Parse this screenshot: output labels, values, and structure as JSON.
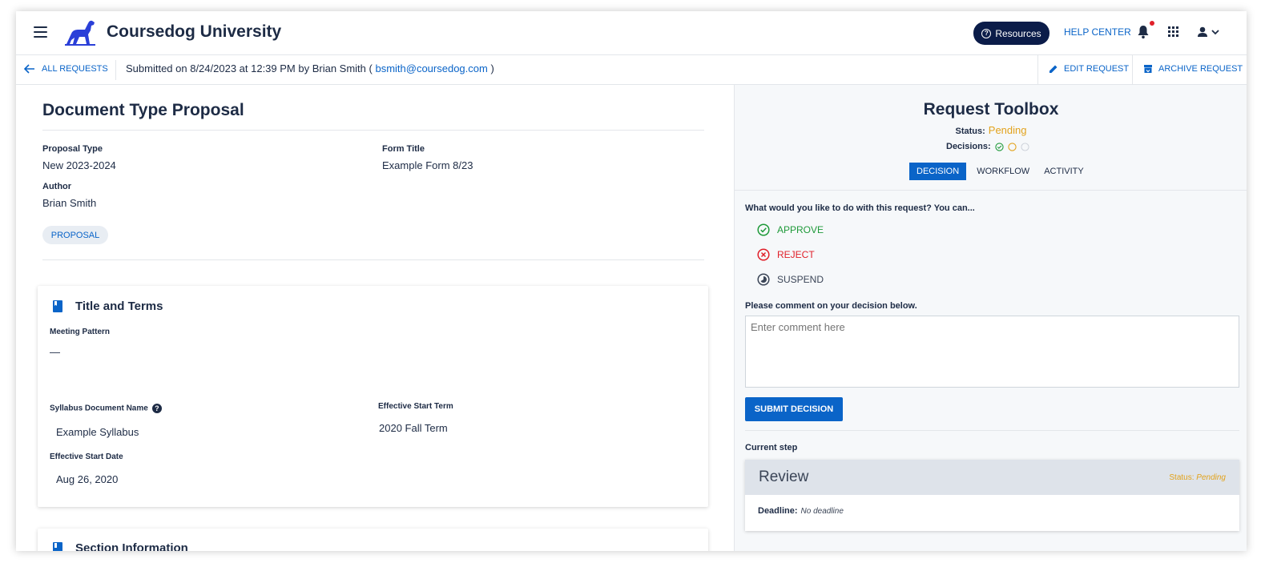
{
  "app": {
    "brand": "Coursedog University",
    "resources_label": "Resources",
    "help_center_label": "HELP CENTER",
    "icons": [
      "menu-icon",
      "dog-logo",
      "question-circle-icon",
      "bell-icon",
      "apps-grid-icon",
      "user-icon",
      "chevron-down-icon"
    ],
    "accent_color": "#0a64c8",
    "dark_navy": "#0b1c49"
  },
  "subbar": {
    "back_label": "ALL REQUESTS",
    "submitted_prefix": "Submitted on 8/24/2023 at 12:39 PM by Brian Smith (",
    "submitted_email": "bsmith@coursedog.com",
    "submitted_suffix": ")",
    "edit_label": "EDIT REQUEST",
    "archive_label": "ARCHIVE REQUEST"
  },
  "proposal": {
    "title": "Document Type Proposal",
    "fields": {
      "proposal_type_label": "Proposal Type",
      "proposal_type_value": "New 2023-2024",
      "form_title_label": "Form Title",
      "form_title_value": "Example Form 8/23",
      "author_label": "Author",
      "author_value": "Brian Smith"
    },
    "tag": "PROPOSAL",
    "sections": [
      {
        "title": "Title and Terms",
        "meeting_pattern_label": "Meeting Pattern",
        "meeting_pattern_value": "—",
        "syllabus_label": "Syllabus Document Name",
        "syllabus_value": "Example Syllabus",
        "effective_start_term_label": "Effective Start Term",
        "effective_start_term_value": "2020 Fall Term",
        "effective_start_date_label": "Effective Start Date",
        "effective_start_date_value": "Aug 26, 2020"
      },
      {
        "title": "Section Information"
      }
    ]
  },
  "toolbox": {
    "title": "Request Toolbox",
    "status_label": "Status:",
    "status_value": "Pending",
    "decisions_label": "Decisions:",
    "decisions": [
      "approved",
      "pending",
      "empty"
    ],
    "tabs": [
      "DECISION",
      "WORKFLOW",
      "ACTIVITY"
    ],
    "active_tab": "DECISION",
    "question": "What would you like to do with this request? You can...",
    "options": [
      "APPROVE",
      "REJECT",
      "SUSPEND"
    ],
    "comment_label": "Please comment on your decision below.",
    "comment_placeholder": "Enter comment here",
    "submit_label": "SUBMIT DECISION",
    "current_step_label": "Current step",
    "step_name": "Review",
    "step_status_label": "Status:",
    "step_status_value": "Pending",
    "deadline_label": "Deadline:",
    "deadline_value": "No deadline",
    "colors": {
      "approve": "#1f9a3a",
      "reject": "#e0202a",
      "pending": "#e2a21b"
    }
  }
}
